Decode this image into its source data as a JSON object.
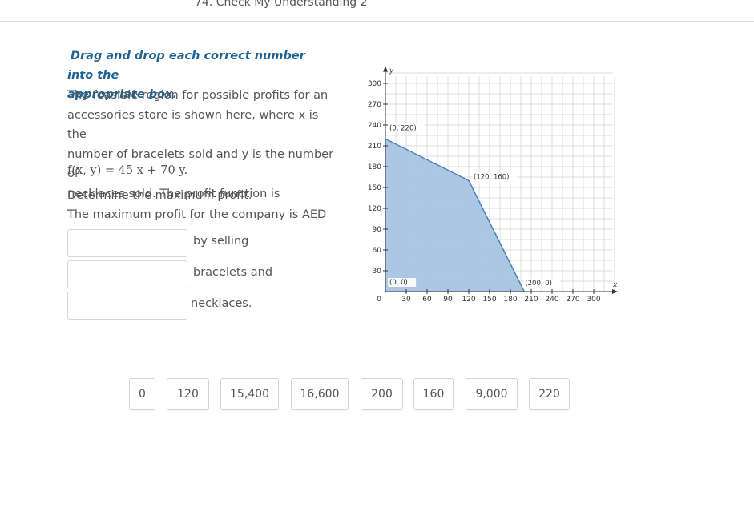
{
  "header": {
    "title": "74. Check My Understanding 2"
  },
  "instruction": {
    "line1": "Drag and drop each correct number into the",
    "line2": "appropriate box."
  },
  "problem": {
    "lines": [
      "The feasible region for possible profits for an",
      "accessories store is shown here, where x is the",
      "number of bracelets sold and y is the number of",
      "necklaces sold. The profit function is"
    ],
    "function": "f(x, y) = 45 x + 70 y.",
    "question": "Determine the maximum profit.",
    "statement": "The maximum profit for the company is AED"
  },
  "answers": {
    "labels": [
      "by selling",
      "bracelets and",
      "necklaces."
    ]
  },
  "chips": [
    "0",
    "120",
    "15,400",
    "16,600",
    "200",
    "160",
    "9,000",
    "220"
  ],
  "chart_data": {
    "type": "area",
    "xlabel": "x",
    "ylabel": "y",
    "xlim": [
      0,
      330
    ],
    "ylim": [
      0,
      320
    ],
    "x_ticks": [
      30,
      60,
      90,
      120,
      150,
      180,
      210,
      240,
      270,
      300
    ],
    "y_ticks": [
      30,
      60,
      90,
      120,
      150,
      180,
      210,
      240,
      270,
      300
    ],
    "origin_label": "0",
    "grid": true,
    "region_color": "#a8c4e2",
    "edge_color": "#3b78b5",
    "vertices": [
      {
        "x": 0,
        "y": 0,
        "label": "(0, 0)"
      },
      {
        "x": 0,
        "y": 220,
        "label": "(0, 220)"
      },
      {
        "x": 120,
        "y": 160,
        "label": "(120, 160)"
      },
      {
        "x": 200,
        "y": 0,
        "label": "(200, 0)"
      }
    ]
  }
}
